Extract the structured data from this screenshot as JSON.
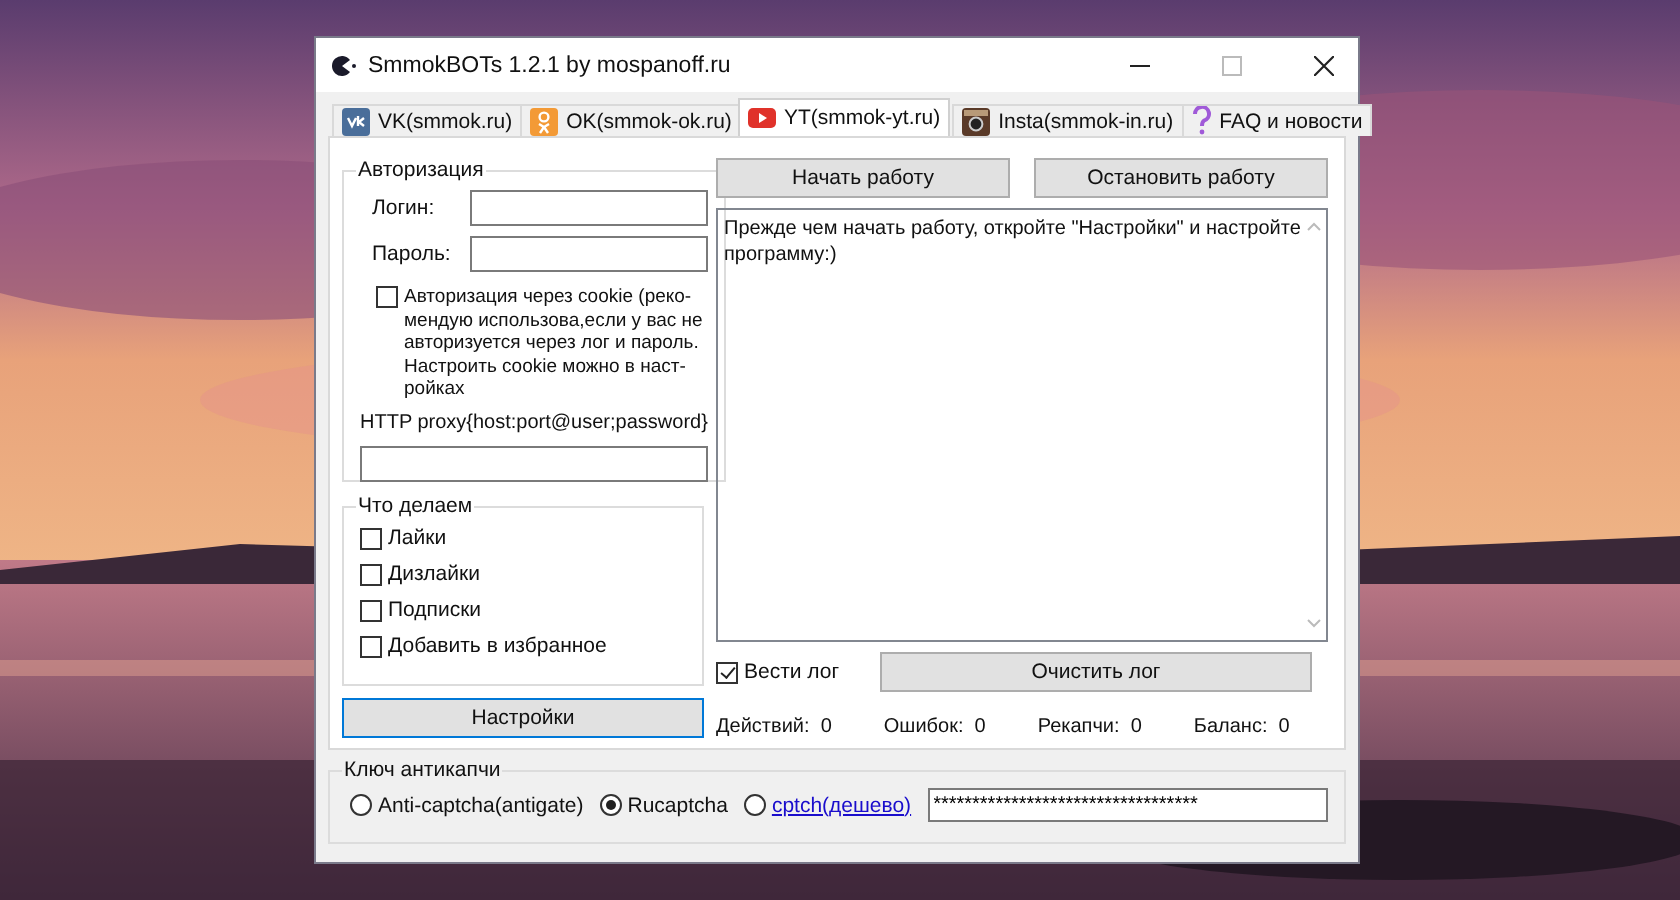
{
  "window": {
    "title": "SmmokBOTs 1.2.1 by mospanoff.ru"
  },
  "tabs": [
    {
      "label": "VK(smmok.ru)",
      "kind": "vk",
      "selected": false
    },
    {
      "label": "OK(smmok-ok.ru)",
      "kind": "ok",
      "selected": false
    },
    {
      "label": "YT(smmok-yt.ru)",
      "kind": "yt",
      "selected": true
    },
    {
      "label": "Insta(smmok-in.ru)",
      "kind": "insta",
      "selected": false
    },
    {
      "label": "FAQ и новости",
      "kind": "faq",
      "selected": false
    }
  ],
  "auth": {
    "title": "Авторизация",
    "login_label": "Логин:",
    "password_label": "Пароль:",
    "cookie": {
      "label": "Авторизация через cookie (реко-мендую использова,если у вас не авторизуется через лог и пароль. Настроить cookie можно в наст-ройках",
      "checked": false
    },
    "proxy_label": "HTTP proxy{host:port@user;password}"
  },
  "actions": {
    "title": "Что делаем",
    "items": [
      {
        "label": "Лайки",
        "checked": false
      },
      {
        "label": "Дизлайки",
        "checked": false
      },
      {
        "label": "Подписки",
        "checked": false
      },
      {
        "label": "Добавить в избранное",
        "checked": false
      }
    ]
  },
  "settings_button": "Настройки",
  "start_button": "Начать работу",
  "stop_button": "Остановить работу",
  "log_text": "Прежде чем начать работу, откройте \"Настройки\" и настройте программу:)",
  "keep_log": {
    "label": "Вести лог",
    "checked": true
  },
  "clear_log_button": "Очистить лог",
  "stats": [
    "Действий:  0",
    "Ошибок:  0",
    "Рекапчи:  0",
    "Баланс:  0"
  ],
  "captcha": {
    "title": "Ключ антикапчи",
    "options": [
      {
        "label": "Anti-captcha(antigate)",
        "kind": "plain",
        "selected": false
      },
      {
        "label": "Rucaptcha",
        "kind": "plain",
        "selected": true
      },
      {
        "label": "cptch(дешево)",
        "kind": "link",
        "selected": false
      }
    ],
    "key": "**********************************"
  }
}
